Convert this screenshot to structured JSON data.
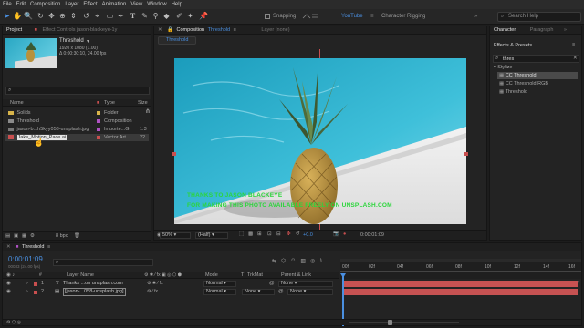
{
  "menu": [
    "File",
    "Edit",
    "Composition",
    "Layer",
    "Effect",
    "Animation",
    "View",
    "Window",
    "Help"
  ],
  "toolbar": {
    "snapping": "Snapping",
    "workspaces": [
      "YouTube",
      "Character Rigging"
    ],
    "search_placeholder": "Search Help"
  },
  "project": {
    "tab": "Project",
    "tab2": "Effect Controls jason-blackeye-1y",
    "selected_name": "Threshold",
    "selected_info1": "1920 x 1080 (1.00)",
    "selected_info2": "Δ 0:00:30:10, 24.00 fps",
    "search_icon": "search-icon",
    "columns": [
      "Name",
      "Type",
      "Size"
    ],
    "items": [
      {
        "name": "Solids",
        "type": "Folder",
        "size": "",
        "color": "#d8b44a"
      },
      {
        "name": "Threshold",
        "type": "Composition",
        "size": "",
        "color": "#b052c4"
      },
      {
        "name": "jason-b...h5kyy058-unsplash.jpg",
        "type": "Importe...G",
        "size": "1.3",
        "color": "#b052c4"
      },
      {
        "name": "Jake_Motion_Pace.ai",
        "type": "Vector Art",
        "size": "22",
        "color": "#c94f4f"
      }
    ],
    "bpc": "8 bpc"
  },
  "composition": {
    "tab": "Composition",
    "tab_name": "Threshold",
    "layer_tab": "Layer  (none)",
    "sub_tab": "Threshold",
    "overlay_text1": "THANKS TO JASON BLACKEYE",
    "overlay_text2": "FOR MAKING THIS PHOTO AVAILABLE FREELY ON UNSPLASH.COM",
    "zoom": "50%",
    "resolution": "(Half)",
    "exposure": "+0.0",
    "timecode": "0:00:01:09"
  },
  "effects": {
    "tab1": "Character",
    "tab2": "Paragraph",
    "title": "Effects & Presets",
    "search_value": "thres",
    "category": "Stylize",
    "items": [
      "CC Threshold",
      "CC Threshold RGB",
      "Threshold"
    ]
  },
  "timeline": {
    "tab": "Threshold",
    "timecode": "0:00:01:09",
    "fps_info": "00033 (24.00 fps)",
    "headers": {
      "layer": "Layer Name",
      "mode": "Mode",
      "trkmat": "TrkMat",
      "parent": "Parent & Link"
    },
    "ruler": [
      "00f",
      "02f",
      "04f",
      "06f",
      "08f",
      "10f",
      "12f",
      "14f",
      "16f"
    ],
    "layers": [
      {
        "num": "1",
        "name": "Thanks ...on unsplash.com",
        "mode": "Normal",
        "trkmat": "",
        "parent": "None",
        "color": "#c94f4f"
      },
      {
        "num": "2",
        "name": "[jason-...058-unsplash.jpg]",
        "mode": "Normal",
        "trkmat": "None",
        "parent": "None",
        "color": "#c94f4f"
      }
    ]
  }
}
